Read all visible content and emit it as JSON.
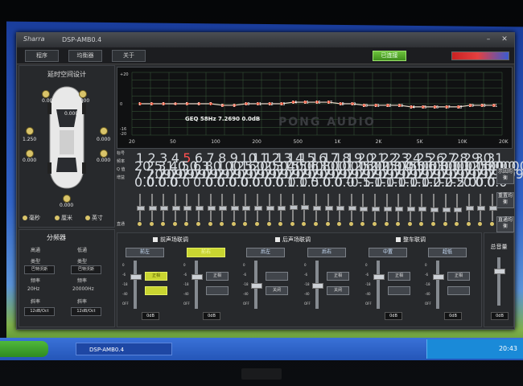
{
  "window": {
    "logo": "Sharra",
    "title": "DSP-AMB0.4",
    "min_icon": "minimize-icon",
    "close_icon": "close-icon"
  },
  "menu": {
    "items": [
      "程序",
      "均衡器",
      "关于"
    ],
    "connect_label": "已连接"
  },
  "delay_panel": {
    "title": "延时空间设计",
    "speakers": {
      "front_left": "0.000",
      "front_right": "0.000",
      "mid_left": "1.250",
      "mid_right": "0.000",
      "rear_left": "0.000",
      "rear_right": "0.000",
      "rear_center": "0.000",
      "top_left": "0.000"
    },
    "units": [
      "毫秒",
      "厘米",
      "英寸"
    ]
  },
  "graph": {
    "info": "GEQ 58Hz 7.2690 0.0dB",
    "watermark": "PONG AUDIO"
  },
  "chart_data": {
    "type": "line",
    "x_ticks": [
      "20",
      "50",
      "100",
      "200",
      "500",
      "1K",
      "2K",
      "5K",
      "10K",
      "20K"
    ],
    "y_ticks": [
      "+20",
      "0",
      "-16",
      "-20"
    ],
    "series": [
      {
        "points": [
          1,
          2,
          3,
          4,
          5,
          6,
          7,
          8,
          9,
          10,
          11,
          12,
          13,
          14,
          15,
          16,
          17,
          18,
          19,
          20,
          21,
          22,
          23,
          24,
          25,
          26,
          27,
          28,
          29,
          30,
          31
        ],
        "values": [
          0,
          0,
          0,
          0,
          0,
          0,
          0,
          -1,
          -1,
          0,
          0,
          0,
          0,
          1,
          1,
          1,
          1,
          0,
          0,
          -1,
          -1,
          -1,
          -1,
          -2,
          -2,
          -2,
          -2,
          -2,
          -1,
          -1,
          -1
        ]
      }
    ],
    "ylim": [
      -20,
      20
    ]
  },
  "eq_table": {
    "row_labels": [
      "标号",
      "频率",
      "Q 值",
      "增益"
    ],
    "bands": [
      "1",
      "2",
      "3",
      "4",
      "5",
      "6",
      "7",
      "8",
      "9",
      "10",
      "11",
      "12",
      "13",
      "14",
      "15",
      "16",
      "17",
      "18",
      "19",
      "20",
      "21",
      "22",
      "23",
      "24",
      "25",
      "26",
      "27",
      "28",
      "29",
      "30",
      "31"
    ],
    "freqs": [
      "20",
      "25",
      "31",
      "40",
      "50",
      "63",
      "80",
      "100",
      "125",
      "160",
      "200",
      "250",
      "315",
      "400",
      "500",
      "630",
      "800",
      "1000",
      "1250",
      "1600",
      "2000",
      "2500",
      "3150",
      "4000",
      "5000",
      "6300",
      "8000",
      "10000",
      "12500",
      "16000",
      "20000"
    ],
    "q": [
      "7.209",
      "7.209",
      "7.209",
      "7.209",
      "7.209",
      "7.209",
      "7.209",
      "7.209",
      "7.209",
      "7.209",
      "7.209",
      "7.209",
      "7.209",
      "7.209",
      "7.209",
      "7.209",
      "7.209",
      "7.209",
      "7.209",
      "7.209",
      "7.209",
      "7.209",
      "7.209",
      "7.209",
      "7.209",
      "7.209",
      "7.209",
      "7.209",
      "7.209",
      "7.209",
      "7.209"
    ],
    "gain": [
      "0.0",
      "0.0",
      "0.0",
      "0.0",
      "",
      "0.0",
      "0.0",
      "0.0",
      "0.0",
      "0.0",
      "0.0",
      "0.0",
      "0.0",
      "1.0",
      "1.5",
      "0.0",
      "0.0",
      "0.0",
      "-0.5",
      "-1.0",
      "-1.0",
      "-1.0",
      "-1.0",
      "-1.0",
      "-1.0",
      "-2.0",
      "-2.5",
      "-2.0",
      "0.0",
      "0.0",
      "0.0"
    ],
    "knob_levels": [
      0.5,
      0.5,
      0.5,
      0.5,
      0.5,
      0.5,
      0.5,
      0.5,
      0.5,
      0.5,
      0.5,
      0.5,
      0.5,
      0.47,
      0.46,
      0.5,
      0.5,
      0.5,
      0.51,
      0.53,
      0.53,
      0.53,
      0.53,
      0.53,
      0.53,
      0.55,
      0.56,
      0.55,
      0.5,
      0.5,
      0.5
    ],
    "bypass_label": "直通",
    "side_buttons": [
      "示因均衡",
      "重置均衡",
      "直通均衡"
    ]
  },
  "crossover": {
    "title": "分频器",
    "high_pass": "高通",
    "low_pass": "低通",
    "type_label": "类型",
    "type_value": "巴特沃斯",
    "freq_label": "频率",
    "hp_freq": "20Hz",
    "lp_freq": "20000Hz",
    "slope_label": "斜率",
    "slope_value": "12dB/Oct"
  },
  "channels": {
    "groups": [
      "前声场联调",
      "后声场联调",
      "整车联调"
    ],
    "list": [
      {
        "name": "前左",
        "active": false,
        "btn1": "正相",
        "btn2": "",
        "on1": true,
        "on2": true,
        "value": "0dB",
        "level": 0.7
      },
      {
        "name": "前右",
        "active": true,
        "btn1": "正相",
        "btn2": "",
        "on1": false,
        "on2": false,
        "value": "0dB",
        "level": 0.7
      },
      {
        "name": "后左",
        "active": false,
        "btn1": "",
        "btn2": "关闭",
        "on1": false,
        "on2": false,
        "value": "",
        "level": 0.5
      },
      {
        "name": "后右",
        "active": false,
        "btn1": "正相",
        "btn2": "关闭",
        "on1": false,
        "on2": false,
        "value": "",
        "level": 0.5
      },
      {
        "name": "中置",
        "active": false,
        "btn1": "正相",
        "btn2": "",
        "on1": false,
        "on2": false,
        "value": "0dB",
        "level": 0.7
      },
      {
        "name": "超低",
        "active": false,
        "btn1": "正相",
        "btn2": "",
        "on1": false,
        "on2": false,
        "value": "0dB",
        "level": 0.7
      }
    ],
    "scale": [
      "0",
      "-6",
      "-18",
      "-40",
      "OFF"
    ]
  },
  "master": {
    "title": "总音量",
    "value": "0dB",
    "level": 0.75
  },
  "taskbar": {
    "item": "DSP-AMB0.4",
    "clock": "20:43"
  }
}
